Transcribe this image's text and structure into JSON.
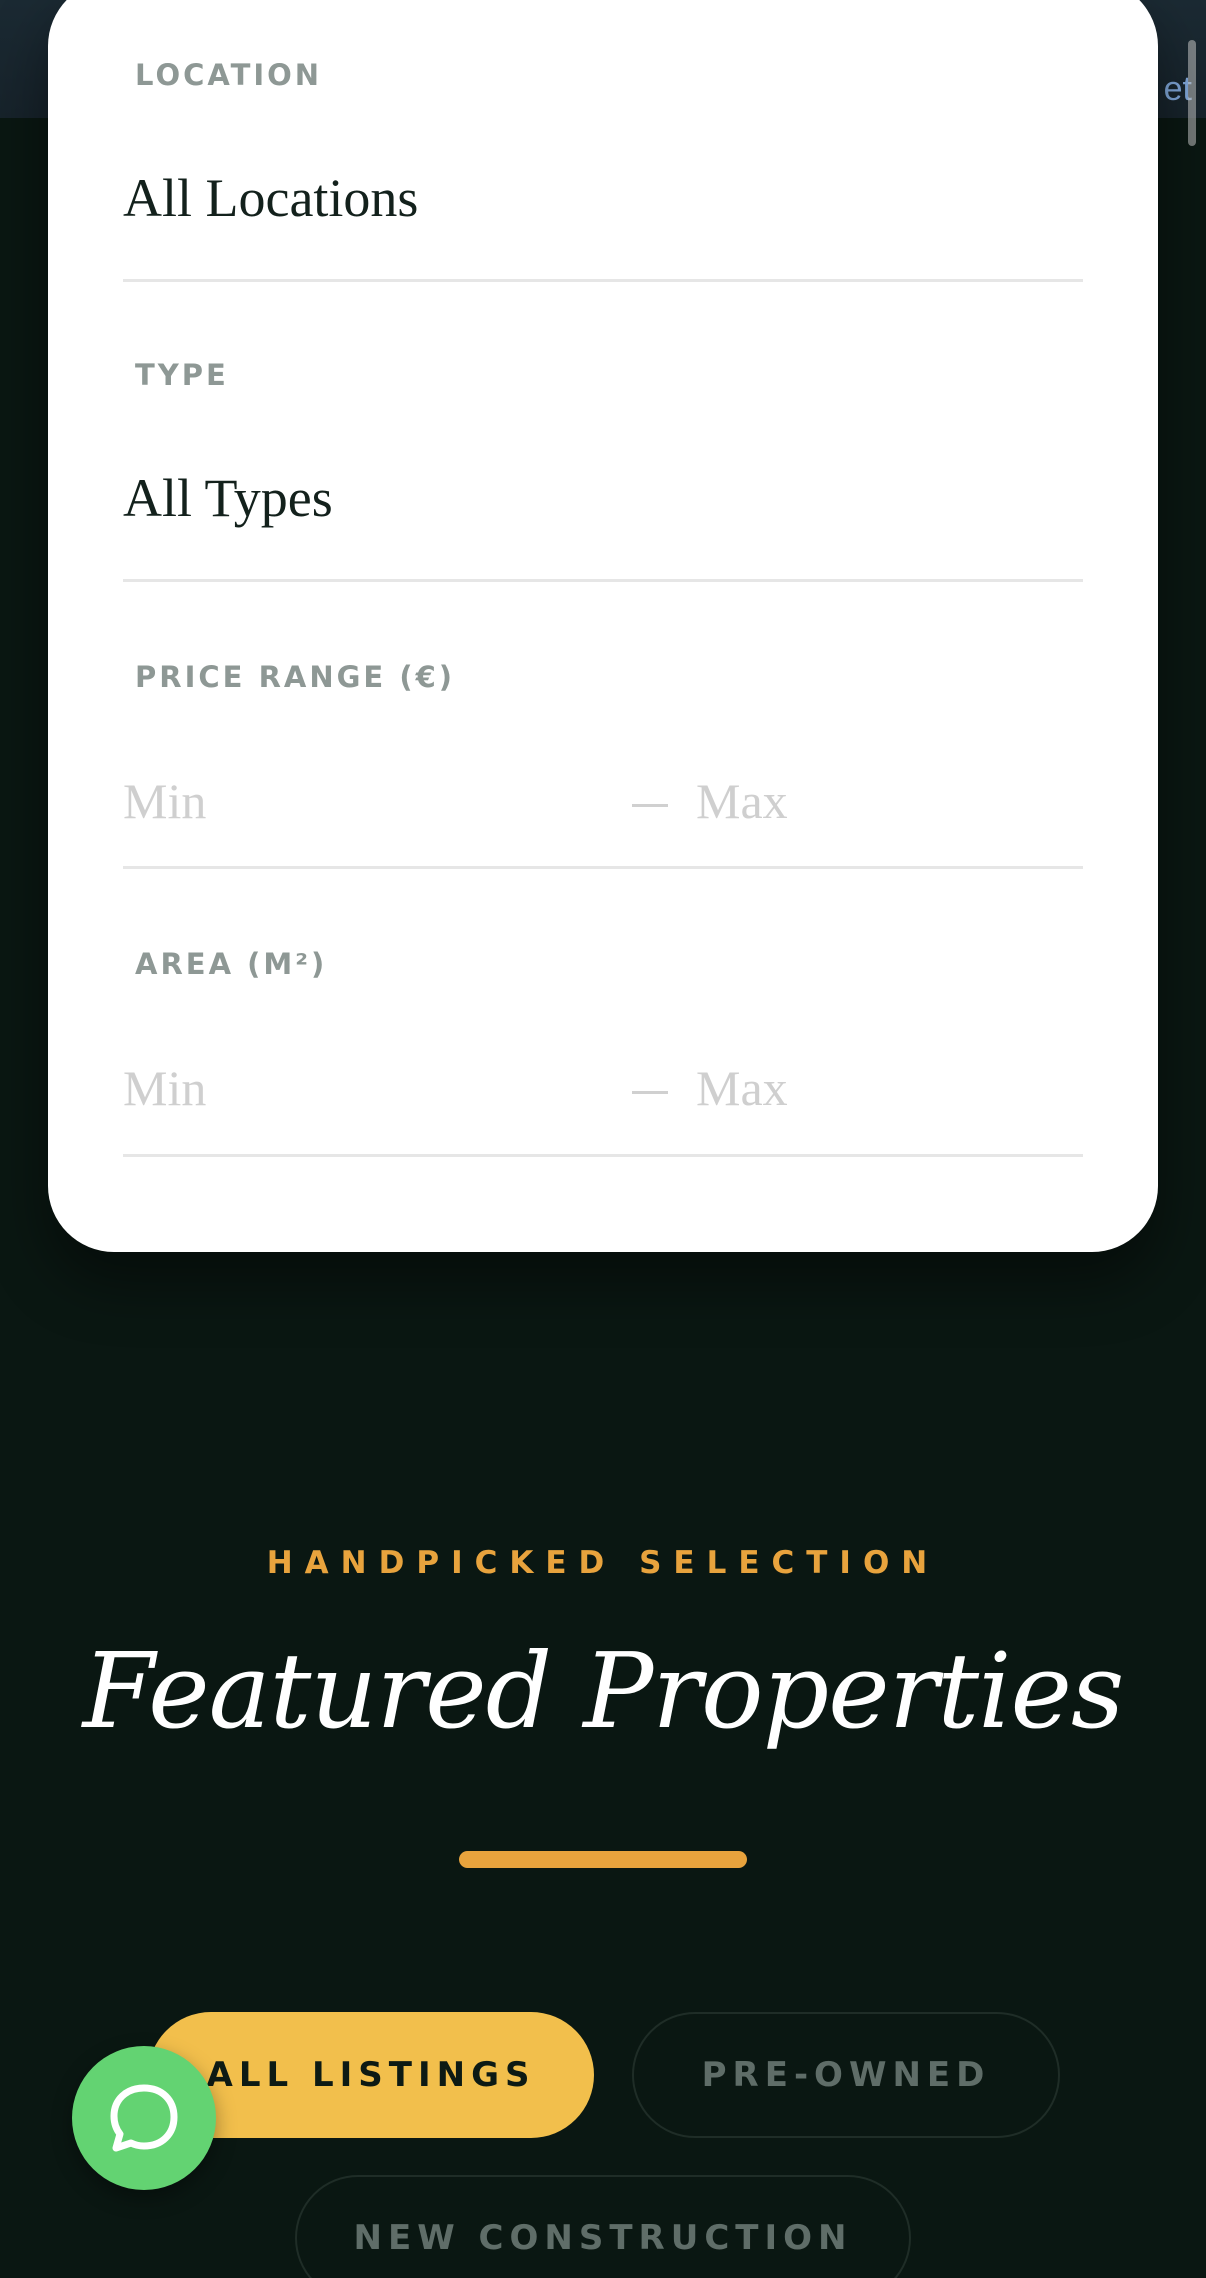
{
  "hero": {
    "peek_text": "et"
  },
  "search_panel": {
    "location": {
      "label": "LOCATION",
      "value": "All Locations"
    },
    "type": {
      "label": "TYPE",
      "value": "All Types"
    },
    "price_range": {
      "label": "PRICE RANGE (€)",
      "min_placeholder": "Min",
      "max_placeholder": "Max"
    },
    "area": {
      "label": "AREA (M²)",
      "min_placeholder": "Min",
      "max_placeholder": "Max"
    }
  },
  "featured": {
    "eyebrow": "HANDPICKED SELECTION",
    "title": "Featured Properties",
    "filters": [
      "ALL LISTINGS",
      "PRE-OWNED",
      "NEW CONSTRUCTION"
    ],
    "active_filter": "ALL LISTINGS"
  },
  "colors": {
    "background": "#0a1712",
    "accent": "#e8a33d",
    "pill_active": "#f2bf4c",
    "whatsapp": "#63d372"
  },
  "icons": {
    "chat": "chat-bubble-icon"
  }
}
